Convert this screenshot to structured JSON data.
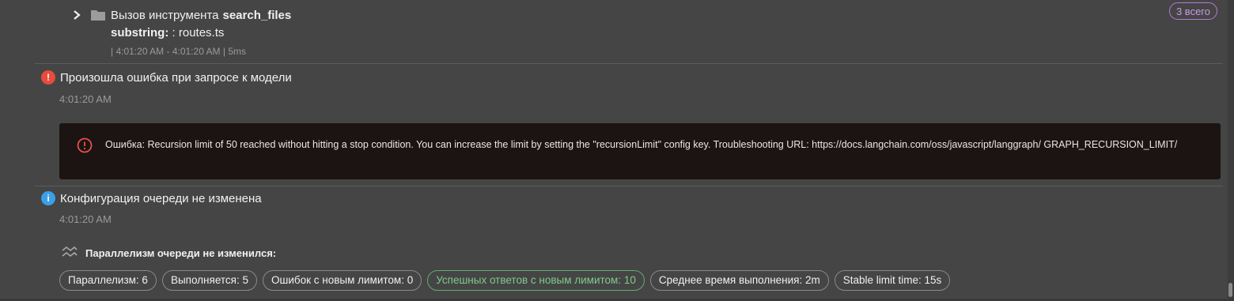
{
  "tool_call": {
    "label": "Вызов инструмента",
    "name": "search_files",
    "param_key": "substring:",
    "param_value": ": routes.ts",
    "timing": "| 4:01:20 AM - 4:01:20 AM | 5ms",
    "total_badge": "3 всего"
  },
  "error_entry": {
    "title": "Произошла ошибка при запросе к модели",
    "time": "4:01:20 AM",
    "message": "Ошибка: Recursion limit of 50 reached without hitting a stop condition. You can increase the limit by setting the \"recursionLimit\" config key. Troubleshooting URL: https://docs.langchain.com/oss/javascript/langgraph/ GRAPH_RECURSION_LIMIT/"
  },
  "info_entry": {
    "title": "Конфигурация очереди не изменена",
    "time": "4:01:20 AM",
    "parallel_heading": "Параллелизм очереди не изменился:",
    "chips": [
      "Параллелизм: 6",
      "Выполняется: 5",
      "Ошибок с новым лимитом: 0",
      "Успешных ответов с новым лимитом: 10",
      "Среднее время выполнения: 2m",
      "Stable limit time: 15s"
    ]
  },
  "colors": {
    "background": "#454545",
    "error": "#e74c3c",
    "info": "#3aa0e8",
    "success": "#5fae6d",
    "badge": "#b57ad8"
  },
  "icons": [
    "chevron-right-icon",
    "folder-icon",
    "error-icon",
    "info-icon",
    "alert-circle-icon",
    "parallel-icon"
  ]
}
